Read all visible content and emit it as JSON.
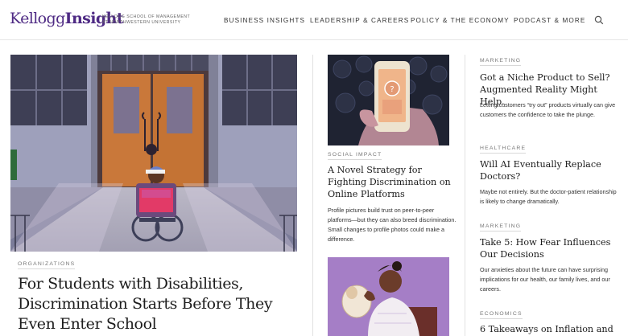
{
  "header": {
    "logo_regular": "Kellogg",
    "logo_bold": "Insight",
    "logo_sub_line1": "Kellogg School of Management",
    "logo_sub_line2": "at Northwestern University",
    "nav": [
      "Business Insights",
      "Leadership & Careers",
      "Policy & the Economy",
      "Podcast & More"
    ],
    "search_icon": "search-icon"
  },
  "hero": {
    "tag": "Organizations",
    "title": "For Students with Disabilities, Discrimination Starts Before They Even Enter School"
  },
  "middle": {
    "tag": "Social Impact",
    "title": "A Novel Strategy for Fighting Discrimination on Online Platforms",
    "description": "Profile pictures build trust on peer-to-peer platforms—but they can also breed discrimination. Small changes to profile photos could make a difference."
  },
  "sidebar": [
    {
      "tag": "Marketing",
      "title": "Got a Niche Product to Sell? Augmented Reality Might Help.",
      "description": "Letting customers “try out” products virtually can give customers the confidence to take the plunge."
    },
    {
      "tag": "Healthcare",
      "title": "Will AI Eventually Replace Doctors?",
      "description": "Maybe not entirely. But the doctor-patient relationship is likely to change dramatically."
    },
    {
      "tag": "Marketing",
      "title": "Take 5: How Fear Influences Our Decisions",
      "description": "Our anxieties about the future can have surprising implications for our health, our family lives, and our careers."
    },
    {
      "tag": "Economics",
      "title": "6 Takeaways on Inflation and the"
    }
  ],
  "colors": {
    "brand": "#4e2a84",
    "door": "#c9783a",
    "phone_bg": "#1f2332",
    "purple_bg": "#a57ec6"
  }
}
